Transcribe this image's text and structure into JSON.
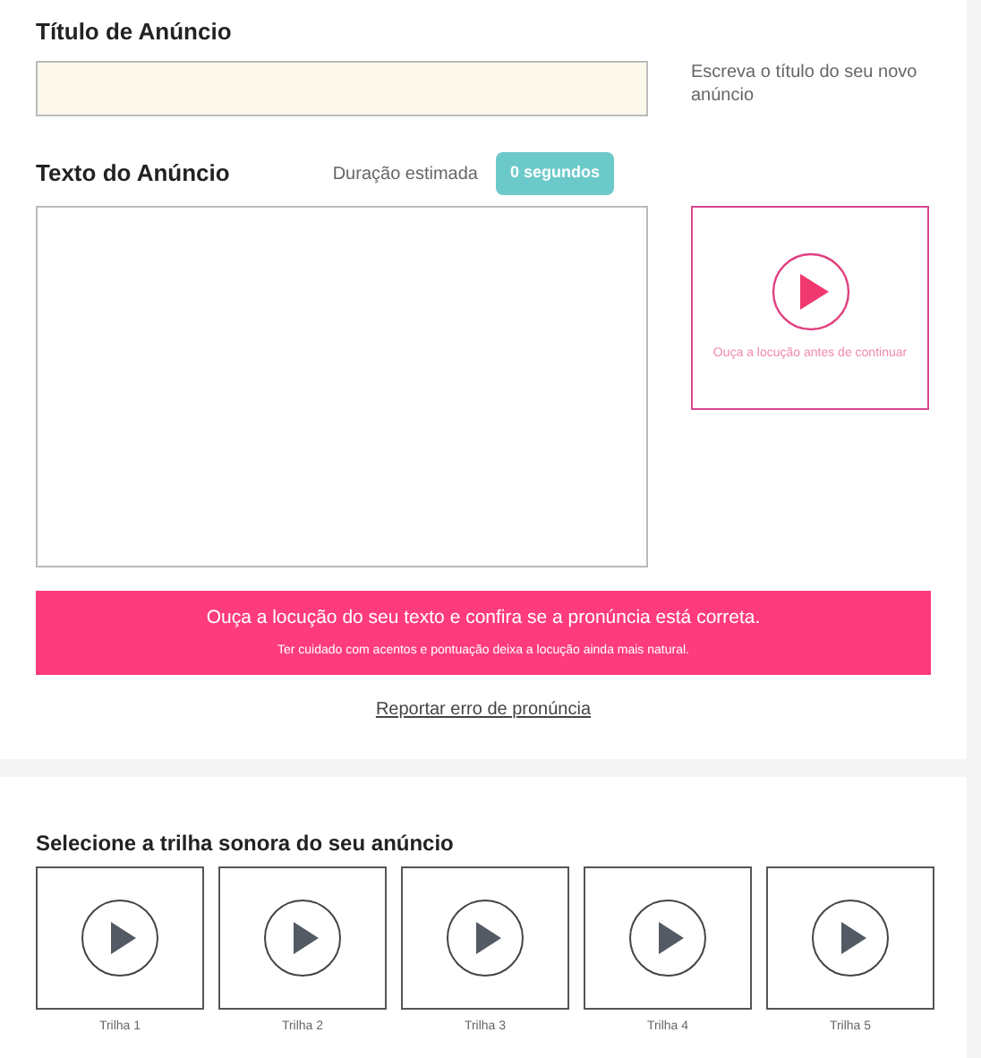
{
  "title_section": {
    "heading": "Título de Anúncio",
    "hint": "Escreva o título do seu novo anúncio"
  },
  "text_section": {
    "heading": "Texto do Anúncio",
    "duration_label": "Duração estimada",
    "duration_value": "0 segundos",
    "preview_caption": "Ouça a locução antes de continuar"
  },
  "banner": {
    "message": "Ouça a locução do seu texto e confira se a pronúncia está correta.",
    "tip": "Ter cuidado com acentos e pontuação deixa a locução ainda mais natural."
  },
  "report_link": "Reportar erro de pronúncia",
  "soundtrack_section": {
    "heading": "Selecione a trilha sonora do seu anúncio",
    "tracks": [
      {
        "label": "Trilha 1",
        "selected": false
      },
      {
        "label": "Trilha 2",
        "selected": false
      },
      {
        "label": "Trilha 3",
        "selected": false
      },
      {
        "label": "Trilha 4",
        "selected": false
      },
      {
        "label": "Trilha 5",
        "selected": false
      }
    ]
  }
}
